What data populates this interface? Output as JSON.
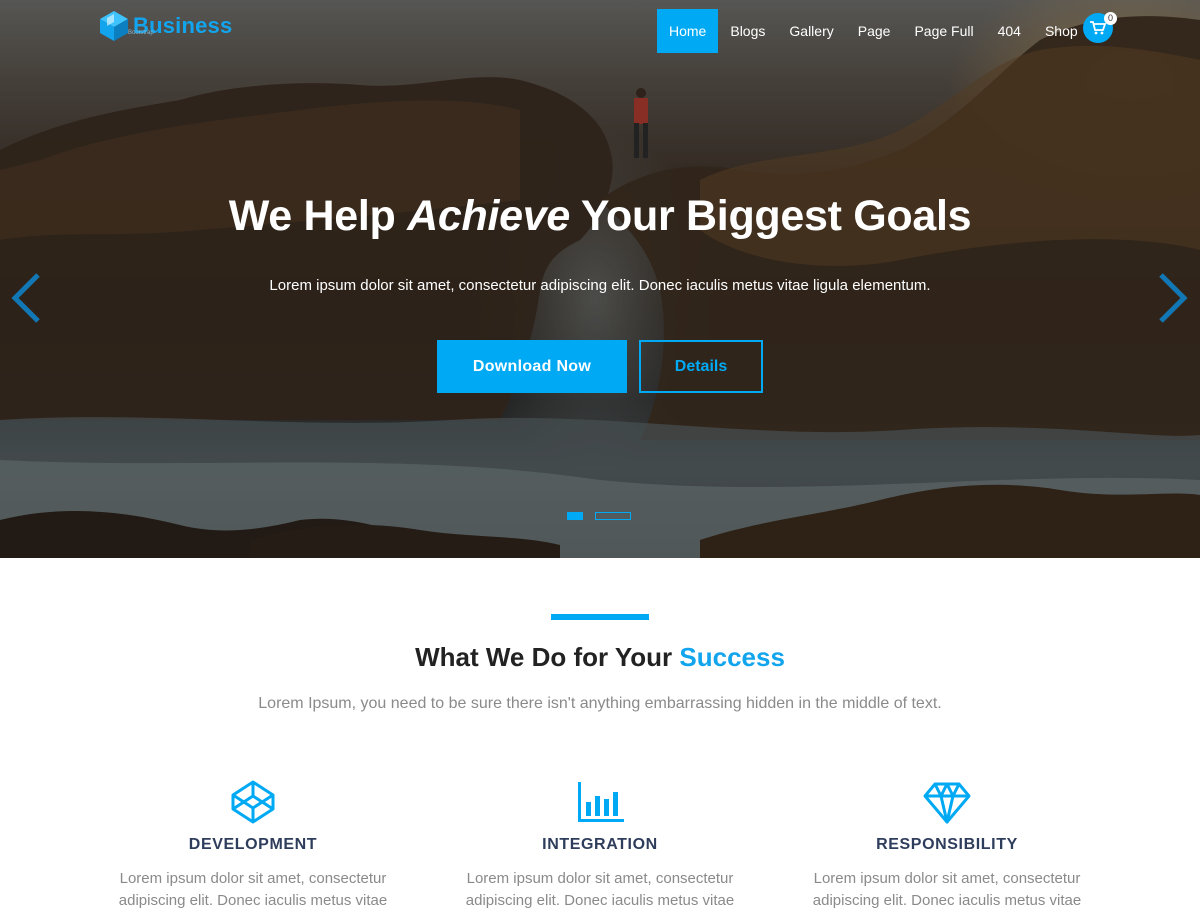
{
  "brand": {
    "name": "Business",
    "tagline": "Bootstrap"
  },
  "nav": {
    "items": [
      {
        "label": "Home",
        "active": true
      },
      {
        "label": "Blogs"
      },
      {
        "label": "Gallery"
      },
      {
        "label": "Page"
      },
      {
        "label": "Page Full"
      },
      {
        "label": "404"
      },
      {
        "label": "Shop"
      }
    ],
    "cart_icon": "shopping-cart-icon",
    "cart_count": "0"
  },
  "hero": {
    "title_pre": "We Help ",
    "title_em": "Achieve",
    "title_post": " Your Biggest Goals",
    "subtitle": "Lorem ipsum dolor sit amet, consectetur adipiscing elit. Donec iaculis metus vitae ligula elementum.",
    "primary_button": "Download Now",
    "secondary_button": "Details",
    "slides": 2,
    "active_slide": 1
  },
  "section": {
    "title_pre": "What We Do for Your ",
    "title_highlight": "Success",
    "subtitle": "Lorem Ipsum, you need to be sure there isn't anything embarrassing hidden in the middle of text."
  },
  "features": [
    {
      "icon": "codepen-cube-icon",
      "title": "DEVELOPMENT",
      "text": "Lorem ipsum dolor sit amet, consectetur adipiscing elit. Donec iaculis metus vitae ligula"
    },
    {
      "icon": "bar-chart-icon",
      "title": "INTEGRATION",
      "text": "Lorem ipsum dolor sit amet, consectetur adipiscing elit. Donec iaculis metus vitae ligula"
    },
    {
      "icon": "diamond-icon",
      "title": "RESPONSIBILITY",
      "text": "Lorem ipsum dolor sit amet, consectetur adipiscing elit. Donec iaculis metus vitae ligula"
    }
  ],
  "colors": {
    "accent": "#00a9f4",
    "heading": "#2f3d5c",
    "muted": "#8a8a8a"
  }
}
